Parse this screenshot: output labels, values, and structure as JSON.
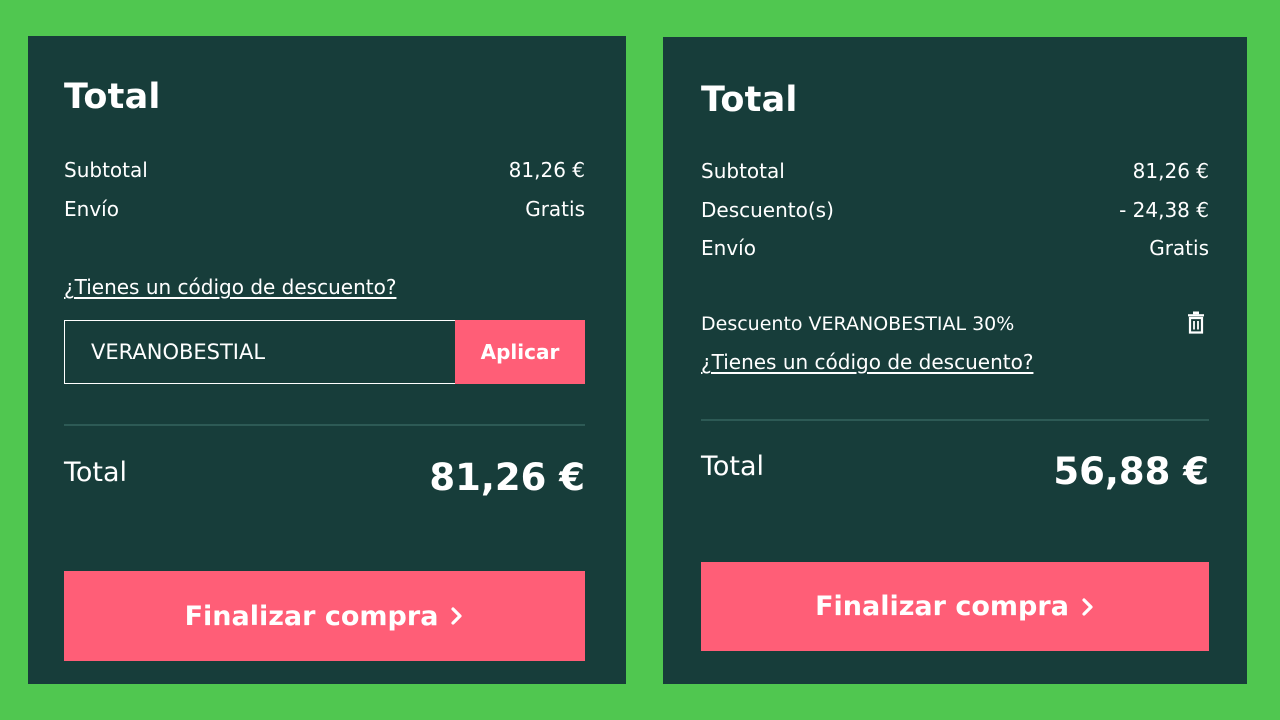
{
  "left_panel": {
    "title": "Total",
    "subtotal_label": "Subtotal",
    "subtotal_value": "81,26 €",
    "shipping_label": "Envío",
    "shipping_value": "Gratis",
    "discount_link": "¿Tienes un código de descuento?",
    "code_input_value": "VERANOBESTIAL",
    "apply_label": "Aplicar",
    "total_label": "Total",
    "total_value": "81,26 €",
    "checkout_label": "Finalizar compra",
    "checkout_icon": "chevron-right-icon"
  },
  "right_panel": {
    "title": "Total",
    "subtotal_label": "Subtotal",
    "subtotal_value": "81,26 €",
    "discounts_label": "Descuento(s)",
    "discounts_value": "- 24,38 €",
    "shipping_label": "Envío",
    "shipping_value": "Gratis",
    "applied_discount": "Descuento VERANOBESTIAL 30%",
    "remove_icon": "trash-icon",
    "discount_link": "¿Tienes un código de descuento?",
    "total_label": "Total",
    "total_value": "56,88 €",
    "checkout_label": "Finalizar compra",
    "checkout_icon": "chevron-right-icon"
  },
  "colors": {
    "background": "#50c750",
    "panel": "#173d3a",
    "accent": "#ff5e77",
    "text": "#ffffff"
  }
}
